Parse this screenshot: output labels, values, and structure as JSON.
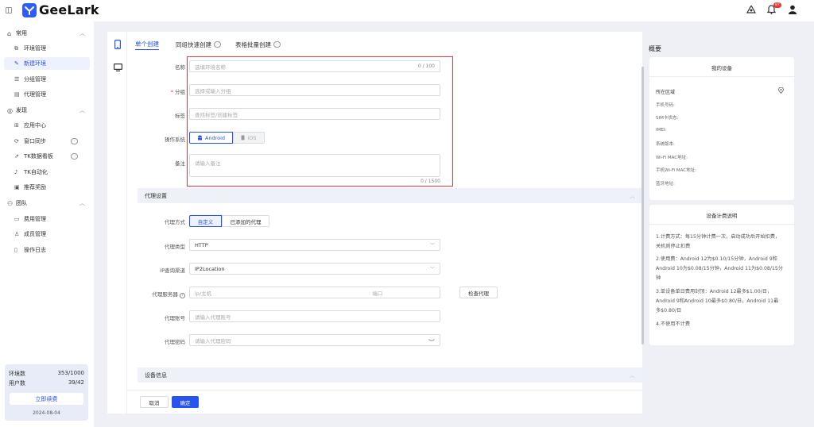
{
  "app": {
    "name": "GeeLark",
    "notification_count": "87"
  },
  "sidebar": {
    "groups": [
      {
        "label": "常用",
        "items": [
          {
            "label": "环境管理",
            "icon": "box-icon"
          },
          {
            "label": "新建环境",
            "icon": "edit-icon",
            "active": true
          },
          {
            "label": "分组管理",
            "icon": "list-icon"
          },
          {
            "label": "代理管理",
            "icon": "server-icon"
          }
        ]
      },
      {
        "label": "发现",
        "items": [
          {
            "label": "应用中心",
            "icon": "apps-icon"
          },
          {
            "label": "窗口同步",
            "icon": "sync-icon",
            "soon": "⋯"
          },
          {
            "label": "TK数据看板",
            "icon": "chart-icon",
            "soon": "⋯"
          },
          {
            "label": "TK自动化",
            "icon": "tiktok-icon"
          },
          {
            "label": "推荐奖励",
            "icon": "gift-icon"
          }
        ]
      },
      {
        "label": "团队",
        "items": [
          {
            "label": "费用管理",
            "icon": "billing-icon"
          },
          {
            "label": "成员管理",
            "icon": "members-icon"
          },
          {
            "label": "操作日志",
            "icon": "log-icon"
          }
        ]
      }
    ],
    "plan": {
      "env_label": "环境数",
      "env_value": "353/1000",
      "user_label": "用户数",
      "user_value": "39/42",
      "renew_label": "立即续费",
      "date": "2024-08-04"
    }
  },
  "tabs": [
    {
      "label": "单个创建",
      "active": true
    },
    {
      "label": "同组快速创建",
      "soon": "⋯"
    },
    {
      "label": "表格批量创建",
      "soon": "⋯"
    }
  ],
  "form": {
    "name_label": "名称",
    "name_placeholder": "选填环境名称",
    "name_counter": "0 / 100",
    "group_label": "分组",
    "group_required": "*",
    "group_placeholder": "选择或输入分组",
    "tags_label": "标签",
    "tags_placeholder": "查找标签/创建标签",
    "os_label": "操作系统",
    "os_android": "Android",
    "os_ios": "iOS",
    "remark_label": "备注",
    "remark_placeholder": "请输入备注",
    "remark_counter": "0 / 1500"
  },
  "proxy": {
    "section_title": "代理设置",
    "method_label": "代理方式",
    "method_custom": "自定义",
    "method_added": "已添加的代理",
    "type_label": "代理类型",
    "type_value": "HTTP",
    "ip_label": "IP查询渠道",
    "ip_value": "IP2Location",
    "server_label": "代理服务器",
    "server_placeholder": "ip/主机",
    "port_placeholder": "端口",
    "port_sep": ":",
    "check_label": "检查代理",
    "account_label": "代理账号",
    "account_placeholder": "请输入代理账号",
    "password_label": "代理密码",
    "password_placeholder": "请输入代理密码"
  },
  "device_section": {
    "title": "设备信息"
  },
  "actions": {
    "cancel": "取消",
    "confirm": "确定"
  },
  "overview": {
    "title": "概要",
    "my_device_title": "我的设备",
    "device_fields": [
      "所在区域",
      "手机号码:",
      "SIM卡状态:",
      "IMEI:",
      "系统版本:",
      "Wi-Fi MAC地址:",
      "手机Wi-Fi MAC地址:",
      "蓝牙地址:"
    ],
    "billing_title": "设备计费说明",
    "billing_items": [
      "1.计费方式：每15分钟计费一次，启动成功后开始扣费，关机则停止扣费",
      "2.使用费：Android 12为$0.10/15分钟，Android 9和Android 10为$0.08/15分钟，Android 11为$0.08/15分钟",
      "3.单设备单日费用封顶：Android 12最多$1.00/日，Android 9和Android 10最多$0.80/日，Android 11最多$0.80/日",
      "4.不使用不计费"
    ]
  },
  "colors": {
    "accent": "#2753f0",
    "highlight": "#e53935"
  }
}
